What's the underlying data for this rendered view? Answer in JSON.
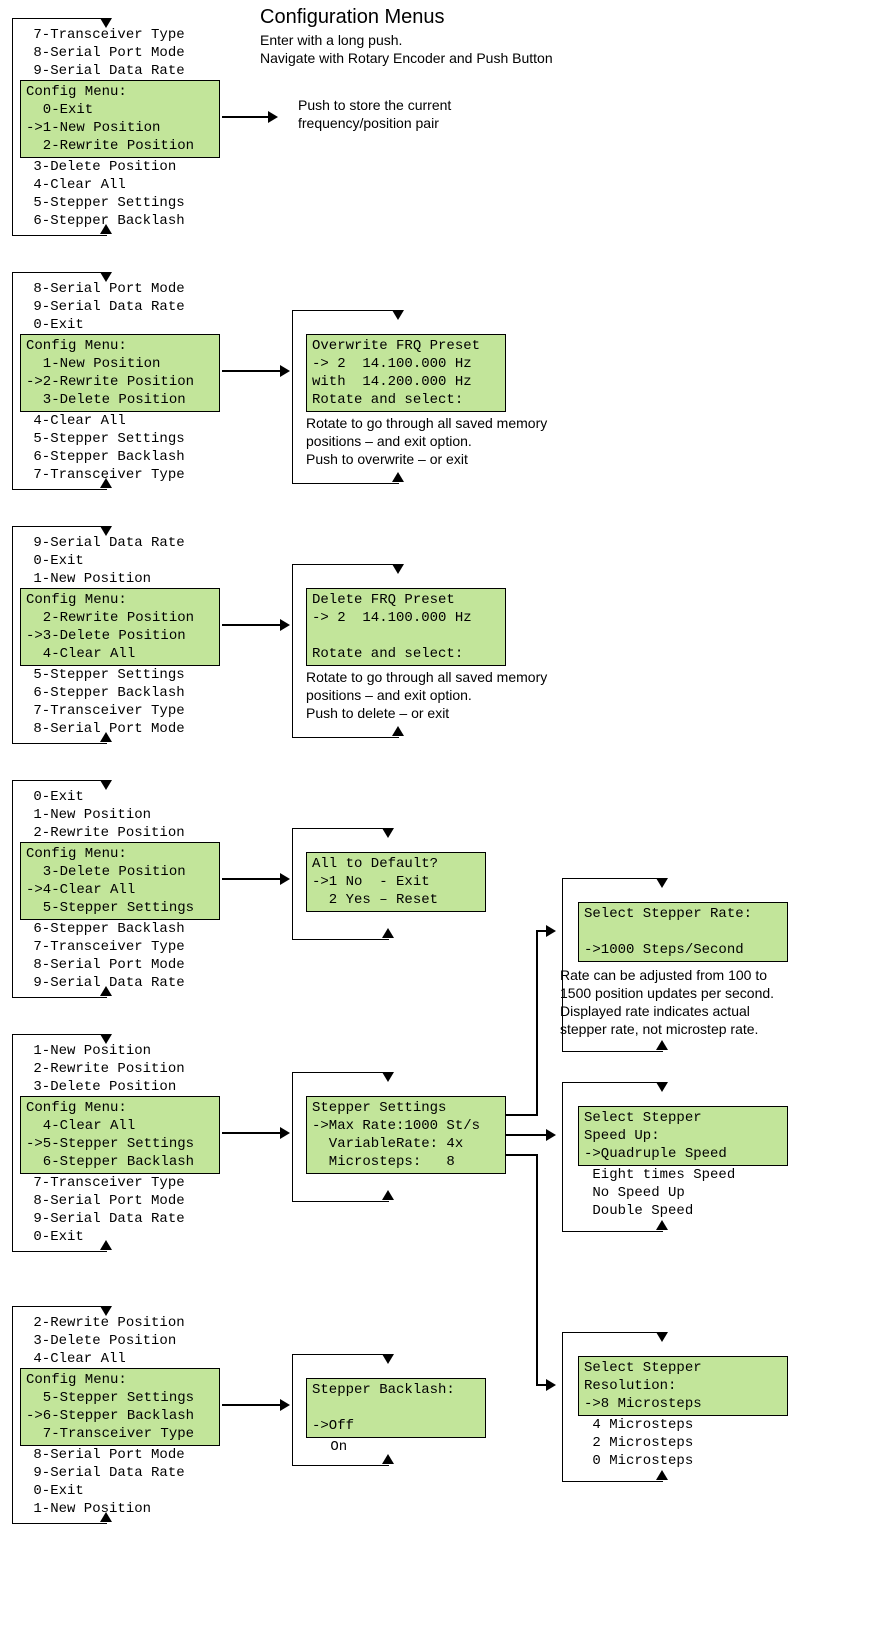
{
  "header": {
    "title": "Configuration Menus",
    "sub1": "Enter with a long push.",
    "sub2": "Navigate with Rotary Encoder and Push Button"
  },
  "notes": {
    "new_pos": "Push to store the current\nfrequency/position pair",
    "rewrite": "Rotate to go through all saved memory\npositions – and exit option.\nPush to overwrite – or exit",
    "delete": "Rotate to go through all saved memory\npositions – and exit option.\nPush to delete – or exit",
    "rate": "Rate can be adjusted from 100 to\n1500 position updates per second.\nDisplayed rate indicates actual\nstepper rate, not microstep rate."
  },
  "block1": {
    "above": " 7-Transceiver Type\n 8-Serial Port Mode\n 9-Serial Data Rate",
    "green": "Config Menu:\n  0-Exit\n->1-New Position\n  2-Rewrite Position",
    "below": " 3-Delete Position\n 4-Clear All\n 5-Stepper Settings\n 6-Stepper Backlash"
  },
  "block2": {
    "above": " 8-Serial Port Mode\n 9-Serial Data Rate\n 0-Exit",
    "green": "Config Menu:\n  1-New Position\n->2-Rewrite Position\n  3-Delete Position",
    "below": " 4-Clear All\n 5-Stepper Settings\n 6-Stepper Backlash\n 7-Transceiver Type"
  },
  "block3": {
    "above": " 9-Serial Data Rate\n 0-Exit\n 1-New Position",
    "green": "Config Menu:\n  2-Rewrite Position\n->3-Delete Position\n  4-Clear All",
    "below": " 5-Stepper Settings\n 6-Stepper Backlash\n 7-Transceiver Type\n 8-Serial Port Mode"
  },
  "block4": {
    "above": " 0-Exit\n 1-New Position\n 2-Rewrite Position",
    "green": "Config Menu:\n  3-Delete Position\n->4-Clear All\n  5-Stepper Settings",
    "below": " 6-Stepper Backlash\n 7-Transceiver Type\n 8-Serial Port Mode\n 9-Serial Data Rate"
  },
  "block5": {
    "above": " 1-New Position\n 2-Rewrite Position\n 3-Delete Position",
    "green": "Config Menu:\n  4-Clear All\n->5-Stepper Settings\n  6-Stepper Backlash",
    "below": " 7-Transceiver Type\n 8-Serial Port Mode\n 9-Serial Data Rate\n 0-Exit"
  },
  "block6": {
    "above": " 2-Rewrite Position\n 3-Delete Position\n 4-Clear All",
    "green": "Config Menu:\n  5-Stepper Settings\n->6-Stepper Backlash\n  7-Transceiver Type",
    "below": " 8-Serial Port Mode\n 9-Serial Data Rate\n 0-Exit\n 1-New Position"
  },
  "sub_rewrite": "Overwrite FRQ Preset\n-> 2  14.100.000 Hz\nwith  14.200.000 Hz\nRotate and select:",
  "sub_delete": "Delete FRQ Preset\n-> 2  14.100.000 Hz\n\nRotate and select:",
  "sub_clear": "All to Default?\n->1 No  - Exit\n  2 Yes – Reset",
  "sub_stepper": "Stepper Settings\n->Max Rate:1000 St/s\n  VariableRate: 4x\n  Microsteps:   8",
  "sub_backlash": "Stepper Backlash:\n \n->Off",
  "sub_backlash_below": " On",
  "sub_rate": "Select Stepper Rate:\n \n->1000 Steps/Second",
  "sub_speed": "Select Stepper\nSpeed Up:\n->Quadruple Speed",
  "sub_speed_below": " Eight times Speed\n No Speed Up\n Double Speed",
  "sub_microsteps": "Select Stepper\nResolution:\n->8 Microsteps",
  "sub_microsteps_below": " 4 Microsteps\n 2 Microsteps\n 0 Microsteps"
}
